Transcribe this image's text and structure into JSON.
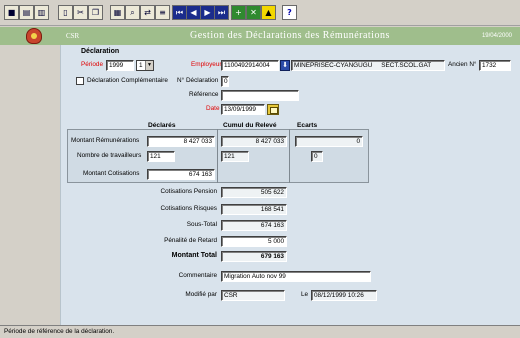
{
  "toolbar": {
    "buttons": [
      {
        "name": "save-icon",
        "glyph": "■"
      },
      {
        "name": "print-icon",
        "glyph": "▤"
      },
      {
        "name": "preview-icon",
        "glyph": "▥"
      },
      {
        "name": "new-doc-icon",
        "glyph": "▯"
      },
      {
        "name": "cut-icon",
        "glyph": "✂"
      },
      {
        "name": "copy-icon",
        "glyph": "❐"
      },
      {
        "name": "paste-icon",
        "glyph": "▦"
      },
      {
        "name": "find-icon",
        "glyph": "⌕"
      },
      {
        "name": "replace-icon",
        "glyph": "⇄"
      },
      {
        "name": "sort-icon",
        "glyph": "≡"
      },
      {
        "name": "first-record-icon",
        "glyph": "⏮"
      },
      {
        "name": "prev-record-icon",
        "glyph": "◀"
      },
      {
        "name": "next-record-icon",
        "glyph": "▶"
      },
      {
        "name": "last-record-icon",
        "glyph": "⏭"
      },
      {
        "name": "add-record-icon",
        "glyph": "+"
      },
      {
        "name": "delete-record-icon",
        "glyph": "✕"
      },
      {
        "name": "lock-icon",
        "glyph": "▲"
      },
      {
        "name": "help-icon",
        "glyph": "?"
      }
    ]
  },
  "header": {
    "app": "CSR",
    "title": "Gestion des Déclarations des Rémunérations",
    "date": "19/04/2000"
  },
  "form": {
    "section_title": "Déclaration",
    "periode_label": "Période",
    "periode_year": "1999",
    "periode_num": "1",
    "employeur_label": "Employeur",
    "employeur_id": "1100492914004",
    "employeur_name": "MINEPRISEC-CYANGUGU",
    "employeur_sect": "SECT.SCOL.GAT",
    "ancien_label": "Ancien N°",
    "ancien_value": "1732",
    "complementaire_label": "Déclaration Complémentaire",
    "n_declaration_label": "N° Déclaration",
    "n_declaration_value": "0",
    "reference_label": "Référence",
    "reference_value": "",
    "date_label": "Date",
    "date_value": "13/09/1999"
  },
  "grid": {
    "col_declares": "Déclarés",
    "col_cumul": "Cumul du Relevé",
    "col_ecarts": "Ecarts",
    "row_remun_label": "Montant Rémunérations",
    "row_remun_declares": "8 427 033",
    "row_remun_cumul": "8 427 033",
    "row_remun_ecart": "0",
    "row_trav_label": "Nombre de travailleurs",
    "row_trav_declares": "121",
    "row_trav_cumul": "121",
    "row_trav_ecart": "0",
    "row_cotis_label": "Montant Cotisations",
    "row_cotis_declares": "674 163"
  },
  "totals": {
    "pension_label": "Cotisations Pension",
    "pension_value": "505 622",
    "risques_label": "Cotisations Risques",
    "risques_value": "168 541",
    "soustotal_label": "Sous-Total",
    "soustotal_value": "674 163",
    "penalite_label": "Pénalité de Retard",
    "penalite_value": "5 000",
    "montant_label": "Montant Total",
    "montant_value": "679 163"
  },
  "footer": {
    "commentaire_label": "Commentaire",
    "commentaire_value": "Migration Auto nov 99",
    "modifie_label": "Modifié par",
    "modifie_value": "CSR",
    "le_label": "Le",
    "le_value": "08/12/1999 10:26"
  },
  "status": {
    "message": "Période de référence de la déclaration."
  }
}
